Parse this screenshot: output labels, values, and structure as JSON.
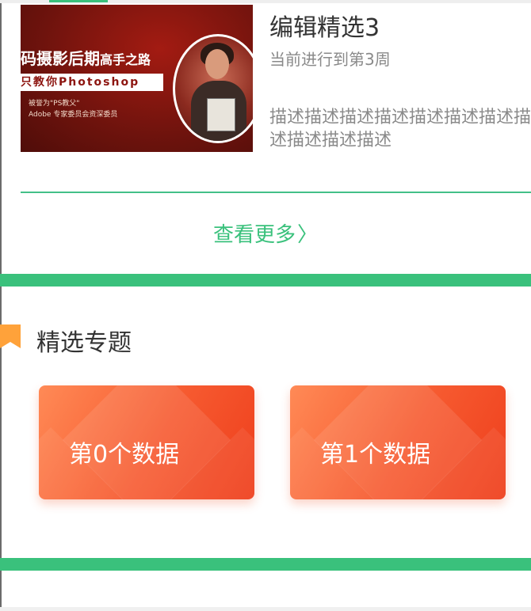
{
  "featured": {
    "thumbnail": {
      "headline": "码摄影后期",
      "headline_suffix": "高手之路",
      "banner": "只教你Photoshop",
      "subtitle_line1": "被誉为\"PS教父\"",
      "subtitle_line2": "Adobe 专家委员会资深委员"
    },
    "title": "编辑精选3",
    "progress": "当前进行到第3周",
    "description": "描述描述描述描述描述描述描述描述描述描述描述"
  },
  "more_link": {
    "label": "查看更多",
    "chevron": "〉"
  },
  "topics": {
    "title": "精选专题",
    "icon": "bookmark-icon",
    "items": [
      {
        "label": "第0个数据"
      },
      {
        "label": "第1个数据"
      }
    ]
  },
  "colors": {
    "accent_green": "#3ac17c",
    "card_orange": "#f6592f",
    "bookmark_orange": "#ffa23a"
  }
}
